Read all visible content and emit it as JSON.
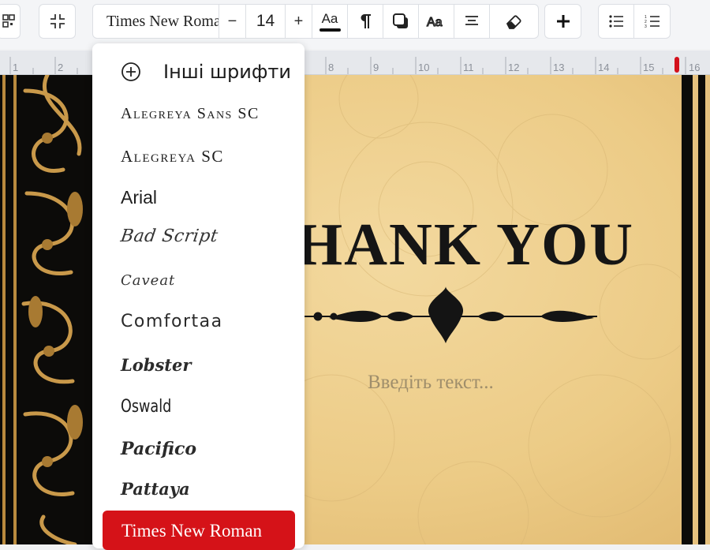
{
  "toolbar": {
    "font_family": "Times New Roman",
    "font_size": "14",
    "decrease_label": "−",
    "increase_label": "+",
    "text_style_label": "Aa"
  },
  "ruler": {
    "ticks": [
      "1",
      "2",
      "8",
      "9",
      "10",
      "11",
      "12",
      "13",
      "14",
      "15",
      "16"
    ]
  },
  "canvas": {
    "headline": "HANK YOU",
    "placeholder": "Введіть текст..."
  },
  "font_menu": {
    "more_fonts": "Інші шрифти",
    "items": [
      "Alegreya Sans SC",
      "Alegreya SC",
      "Arial",
      "Bad Script",
      "Caveat",
      "Comfortaa",
      "Lobster",
      "Oswald",
      "Pacifico",
      "Pattaya",
      "Times New Roman"
    ],
    "selected": "Times New Roman"
  },
  "colors": {
    "accent": "#d51218",
    "canvas_gold": "#eccb86",
    "border_black": "#0c0b09"
  }
}
